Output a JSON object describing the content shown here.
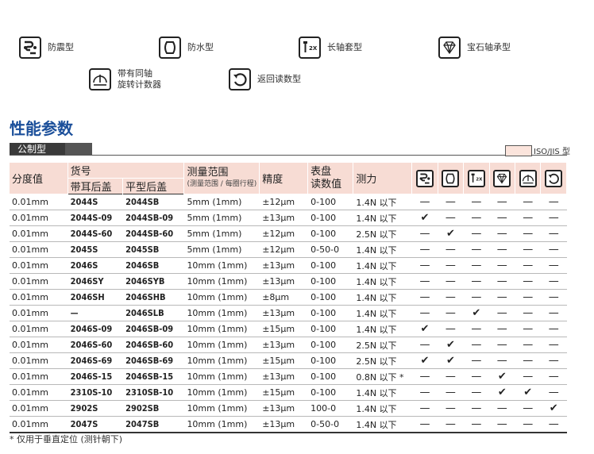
{
  "legend": [
    {
      "icon": "shockproof-icon",
      "label": "防震型"
    },
    {
      "icon": "waterproof-icon",
      "label": "防水型"
    },
    {
      "icon": "long-stem-icon",
      "label": "长轴套型"
    },
    {
      "icon": "jewel-bearing-icon",
      "label": "宝石轴承型"
    },
    {
      "icon": "revolution-counter-icon",
      "label_line1": "带有同轴",
      "label_line2": "旋转计数器"
    },
    {
      "icon": "reverse-reading-icon",
      "label": "返回读数型"
    }
  ],
  "title": "性能参数",
  "section_label": "公制型",
  "iso_label": "ISO/JIS 型",
  "iso_color": "#fbe4dc",
  "title_color": "#1b4f9a",
  "table": {
    "headers": {
      "graduation": "分度值",
      "order_no": "货号",
      "lug_back": "带耳后盖",
      "flat_back": "平型后盖",
      "range": "测量范围",
      "range_sub": "(测量范围 / 每圈行程)",
      "accuracy": "精度",
      "dial_line1": "表盘",
      "dial_line2": "读数值",
      "force": "测力"
    },
    "rows": [
      {
        "grad": "0.01mm",
        "lug": "2044S",
        "flat": "2044SB",
        "range": "5mm (1mm)",
        "acc": "±12μm",
        "dial": "0-100",
        "force": "1.4N 以下",
        "m": [
          "—",
          "—",
          "—",
          "—",
          "—",
          "—"
        ]
      },
      {
        "grad": "0.01mm",
        "lug": "2044S-09",
        "flat": "2044SB-09",
        "range": "5mm (1mm)",
        "acc": "±13μm",
        "dial": "0-100",
        "force": "1.4N 以下",
        "m": [
          "✔",
          "—",
          "—",
          "—",
          "—",
          "—"
        ]
      },
      {
        "grad": "0.01mm",
        "lug": "2044S-60",
        "flat": "2044SB-60",
        "range": "5mm (1mm)",
        "acc": "±12μm",
        "dial": "0-100",
        "force": "2.5N 以下",
        "m": [
          "—",
          "✔",
          "—",
          "—",
          "—",
          "—"
        ]
      },
      {
        "grad": "0.01mm",
        "lug": "2045S",
        "flat": "2045SB",
        "range": "5mm (1mm)",
        "acc": "±12μm",
        "dial": "0-50-0",
        "force": "1.4N 以下",
        "m": [
          "—",
          "—",
          "—",
          "—",
          "—",
          "—"
        ]
      },
      {
        "grad": "0.01mm",
        "lug": "2046S",
        "flat": "2046SB",
        "range": "10mm (1mm)",
        "acc": "±13μm",
        "dial": "0-100",
        "force": "1.4N 以下",
        "m": [
          "—",
          "—",
          "—",
          "—",
          "—",
          "—"
        ]
      },
      {
        "grad": "0.01mm",
        "lug": "2046SY",
        "flat": "2046SYB",
        "range": "10mm (1mm)",
        "acc": "±13μm",
        "dial": "0-100",
        "force": "1.4N 以下",
        "m": [
          "—",
          "—",
          "—",
          "—",
          "—",
          "—"
        ]
      },
      {
        "grad": "0.01mm",
        "lug": "2046SH",
        "flat": "2046SHB",
        "range": "10mm (1mm)",
        "acc": "±8μm",
        "dial": "0-100",
        "force": "1.4N 以下",
        "m": [
          "—",
          "—",
          "—",
          "—",
          "—",
          "—"
        ]
      },
      {
        "grad": "0.01mm",
        "lug": "—",
        "flat": "2046SLB",
        "range": "10mm (1mm)",
        "acc": "±13μm",
        "dial": "0-100",
        "force": "1.4N 以下",
        "m": [
          "—",
          "—",
          "✔",
          "—",
          "—",
          "—"
        ]
      },
      {
        "grad": "0.01mm",
        "lug": "2046S-09",
        "flat": "2046SB-09",
        "range": "10mm (1mm)",
        "acc": "±15μm",
        "dial": "0-100",
        "force": "1.4N 以下",
        "m": [
          "✔",
          "—",
          "—",
          "—",
          "—",
          "—"
        ]
      },
      {
        "grad": "0.01mm",
        "lug": "2046S-60",
        "flat": "2046SB-60",
        "range": "10mm (1mm)",
        "acc": "±13μm",
        "dial": "0-100",
        "force": "2.5N 以下",
        "m": [
          "—",
          "✔",
          "—",
          "—",
          "—",
          "—"
        ]
      },
      {
        "grad": "0.01mm",
        "lug": "2046S-69",
        "flat": "2046SB-69",
        "range": "10mm (1mm)",
        "acc": "±15μm",
        "dial": "0-100",
        "force": "2.5N 以下",
        "m": [
          "✔",
          "✔",
          "—",
          "—",
          "—",
          "—"
        ]
      },
      {
        "grad": "0.01mm",
        "lug": "2046S-15",
        "flat": "2046SB-15",
        "range": "10mm (1mm)",
        "acc": "±13μm",
        "dial": "0-100",
        "force": "0.8N 以下 *",
        "m": [
          "—",
          "—",
          "—",
          "✔",
          "—",
          "—"
        ]
      },
      {
        "grad": "0.01mm",
        "lug": "2310S-10",
        "flat": "2310SB-10",
        "range": "10mm (1mm)",
        "acc": "±15μm",
        "dial": "0-100",
        "force": "1.4N 以下",
        "m": [
          "—",
          "—",
          "—",
          "✔",
          "✔",
          "—"
        ]
      },
      {
        "grad": "0.01mm",
        "lug": "2902S",
        "flat": "2902SB",
        "range": "10mm (1mm)",
        "acc": "±13μm",
        "dial": "100-0",
        "force": "1.4N 以下",
        "m": [
          "—",
          "—",
          "—",
          "—",
          "—",
          "✔"
        ]
      },
      {
        "grad": "0.01mm",
        "lug": "2047S",
        "flat": "2047SB",
        "range": "10mm (1mm)",
        "acc": "±13μm",
        "dial": "0-50-0",
        "force": "1.4N 以下",
        "m": [
          "—",
          "—",
          "—",
          "—",
          "—",
          "—"
        ]
      }
    ]
  },
  "footnote": "* 仅用于垂直定位 (测针朝下)"
}
